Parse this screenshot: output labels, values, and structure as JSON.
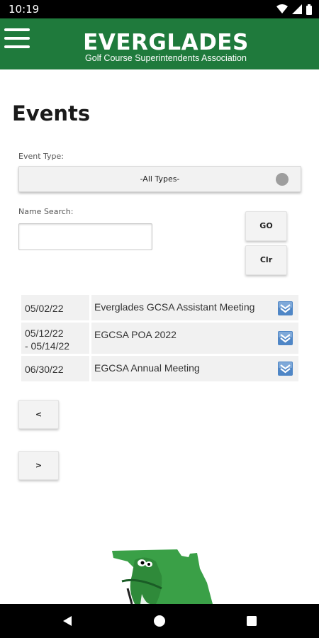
{
  "status_bar": {
    "time": "10:19"
  },
  "header": {
    "title": "EVERGLADES",
    "subtitle": "Golf Course Superintendents Association"
  },
  "page": {
    "title": "Events"
  },
  "filters": {
    "event_type_label": "Event Type:",
    "event_type_value": "-All Types-",
    "name_search_label": "Name Search:",
    "name_search_value": "",
    "go_label": "GO",
    "clear_label": "Clr"
  },
  "events": [
    {
      "date": "05/02/22",
      "date_end": "",
      "name": "Everglades GCSA Assistant Meeting"
    },
    {
      "date": "05/12/22",
      "date_end": "- 05/14/22",
      "name": "EGCSA POA 2022"
    },
    {
      "date": "06/30/22",
      "date_end": "",
      "name": "EGCSA Annual Meeting"
    }
  ],
  "pagination": {
    "prev_label": "<",
    "next_label": ">"
  },
  "colors": {
    "brand_green": "#1f7a3c",
    "expand_icon_blue": "#4f86c6",
    "row_background": "#f1f1f1"
  },
  "icons": {
    "menu": "hamburger-menu-icon",
    "expand": "double-chevron-down-icon",
    "logo": "alligator-florida-logo-icon",
    "nav_back": "triangle-back-icon",
    "nav_home": "circle-home-icon",
    "nav_recents": "square-recents-icon"
  }
}
